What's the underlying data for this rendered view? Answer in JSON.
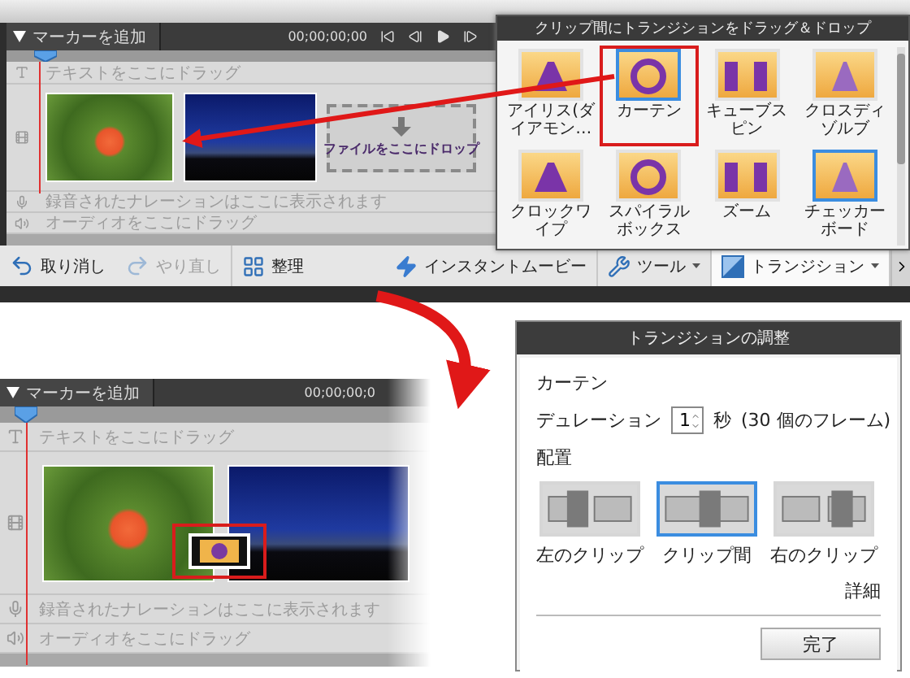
{
  "top_editor": {
    "marker_button": "マーカーを追加",
    "timecode": "00;00;00;00",
    "tracks": [
      {
        "kind": "text",
        "hint": "テキストをここにドラッグ"
      },
      {
        "kind": "video"
      },
      {
        "kind": "narration",
        "hint": "録音されたナレーションはここに表示されます"
      },
      {
        "kind": "audio",
        "hint": "オーディオをここにドラッグ"
      }
    ],
    "drop_zone": "ファイルをここにドロップ",
    "toolbar_left": [
      {
        "kind": "undo",
        "label": "取り消し",
        "disabled": false
      },
      {
        "kind": "redo",
        "label": "やり直し",
        "disabled": true
      },
      {
        "kind": "organize",
        "label": "整理",
        "disabled": false
      }
    ],
    "toolbar_right": [
      {
        "kind": "instant",
        "label": "インスタントムービー",
        "selected": false,
        "dropdown": false
      },
      {
        "kind": "tools",
        "label": "ツール",
        "selected": false,
        "dropdown": true
      },
      {
        "kind": "transitions",
        "label": "トランジション",
        "selected": true,
        "dropdown": true
      }
    ]
  },
  "transitions_panel": {
    "title": "クリップ間にトランジションをドラッグ＆ドロップ",
    "items": [
      {
        "label": "アイリス(ダイアモン…",
        "selected": false,
        "callout": false
      },
      {
        "label": "カーテン",
        "selected": true,
        "callout": true
      },
      {
        "label": "キューブスピン",
        "selected": false,
        "callout": false
      },
      {
        "label": "クロスディゾルブ",
        "selected": false,
        "callout": false
      },
      {
        "label": "クロックワイプ",
        "selected": false,
        "callout": false
      },
      {
        "label": "スパイラルボックス",
        "selected": false,
        "callout": false
      },
      {
        "label": "ズーム",
        "selected": false,
        "callout": false
      },
      {
        "label": "チェッカーボード",
        "selected": true,
        "callout": false
      }
    ]
  },
  "bottom_editor": {
    "marker_button": "マーカーを追加",
    "timecode": "00;00;00;0",
    "tracks": [
      {
        "kind": "text",
        "hint": "テキストをここにドラッグ"
      },
      {
        "kind": "video"
      },
      {
        "kind": "narration",
        "hint": "録音されたナレーションはここに表示されます"
      },
      {
        "kind": "audio",
        "hint": "オーディオをここにドラッグ"
      }
    ],
    "transition_marker": {
      "callout": true
    }
  },
  "dialog": {
    "title": "トランジションの調整",
    "effect_name": "カーテン",
    "duration_label": "デュレーション",
    "duration_value": "1",
    "duration_unit": "秒",
    "frames": "(30 個のフレーム)",
    "alignment_label": "配置",
    "alignment": [
      {
        "kind": "left",
        "label": "左のクリップ",
        "selected": false
      },
      {
        "kind": "center",
        "label": "クリップ間",
        "selected": true
      },
      {
        "kind": "right",
        "label": "右のクリップ",
        "selected": false
      }
    ],
    "details_link": "詳細",
    "done_button": "完了"
  }
}
